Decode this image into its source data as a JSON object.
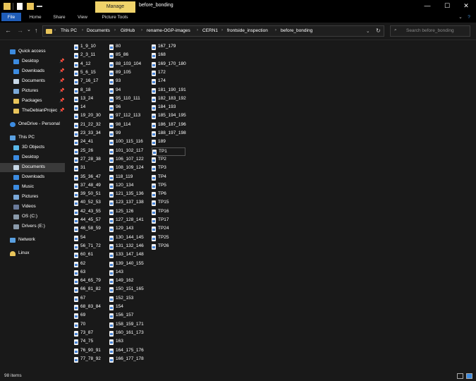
{
  "titlebar": {
    "manage_label": "Manage",
    "window_title": "before_bonding",
    "min_glyph": "—",
    "max_glyph": "☐",
    "close_glyph": "✕"
  },
  "ribbon": {
    "tabs": [
      "File",
      "Home",
      "Share",
      "View",
      "Picture Tools"
    ],
    "help_glyph": "?",
    "expand_glyph": "⌄"
  },
  "nav": {
    "back": "←",
    "forward": "→",
    "recent": "⌄",
    "up": "↑",
    "path": [
      "This PC",
      "Documents",
      "GitHub",
      "rename-OGP-images",
      "CERN1",
      "frontside_inspection",
      "before_bonding"
    ],
    "dropdown": "⌄",
    "refresh": "↻"
  },
  "search": {
    "placeholder": "Search before_bonding"
  },
  "sidebar": {
    "items": [
      {
        "label": "Quick access",
        "icon": "star-icon",
        "pinned": false
      },
      {
        "label": "Desktop",
        "icon": "desktop-icon",
        "pinned": true
      },
      {
        "label": "Downloads",
        "icon": "download-icon",
        "pinned": true
      },
      {
        "label": "Documents",
        "icon": "document-icon",
        "pinned": true
      },
      {
        "label": "Pictures",
        "icon": "picture-icon",
        "pinned": true
      },
      {
        "label": "Packages",
        "icon": "folder-icon",
        "pinned": true
      },
      {
        "label": "TheDebianProjec",
        "icon": "folder-icon",
        "pinned": true
      },
      {
        "label": "OneDrive - Personal",
        "icon": "cloud-icon",
        "pinned": false
      },
      {
        "label": "This PC",
        "icon": "computer-icon",
        "pinned": false
      },
      {
        "label": "3D Objects",
        "icon": "cube-icon",
        "pinned": false
      },
      {
        "label": "Desktop",
        "icon": "desktop-icon",
        "pinned": false
      },
      {
        "label": "Documents",
        "icon": "document-icon",
        "pinned": false,
        "selected": true
      },
      {
        "label": "Downloads",
        "icon": "download-icon",
        "pinned": false
      },
      {
        "label": "Music",
        "icon": "music-icon",
        "pinned": false
      },
      {
        "label": "Pictures",
        "icon": "picture-icon",
        "pinned": false
      },
      {
        "label": "Videos",
        "icon": "video-icon",
        "pinned": false
      },
      {
        "label": "OS (C:)",
        "icon": "drive-icon",
        "pinned": false
      },
      {
        "label": "Drivers (E:)",
        "icon": "drive-icon",
        "pinned": false
      },
      {
        "label": "Network",
        "icon": "network-icon",
        "pinned": false
      },
      {
        "label": "Linux",
        "icon": "linux-icon",
        "pinned": false
      }
    ]
  },
  "files": {
    "columns": [
      [
        "1_9_10",
        "2_3_11",
        "4_12",
        "5_6_15",
        "7_16_17",
        "8_18",
        "13_24",
        "14",
        "19_20_30",
        "21_22_32",
        "23_33_34",
        "24_41",
        "25_26",
        "27_28_38",
        "31",
        "35_36_47",
        "37_48_49",
        "39_50_51",
        "40_52_53",
        "42_43_55",
        "44_45_57",
        "46_58_59",
        "54",
        "56_71_72",
        "60_61",
        "62",
        "63",
        "64_65_79",
        "66_81_82",
        "67",
        "68_83_84",
        "69",
        "70",
        "73_87",
        "74_75",
        "76_90_91",
        "77_78_92"
      ],
      [
        "80",
        "85_86",
        "88_103_104",
        "89_105",
        "93",
        "94",
        "95_110_111",
        "96",
        "97_112_113",
        "98_114",
        "99",
        "100_115_116",
        "101_102_117",
        "106_107_122",
        "108_109_124",
        "118_119",
        "120_134",
        "121_135_136",
        "123_137_138",
        "125_126",
        "127_128_141",
        "129_143",
        "130_144_145",
        "131_132_146",
        "133_147_148",
        "139_140_155",
        "143",
        "149_162",
        "150_151_165",
        "152_153",
        "154",
        "156_157",
        "158_159_171",
        "160_161_173",
        "163",
        "164_175_176",
        "166_177_178"
      ],
      [
        "167_179",
        "168",
        "169_170_180",
        "172",
        "174",
        "181_190_191",
        "182_183_192",
        "184_193",
        "185_194_195",
        "186_187_196",
        "188_197_198",
        "189",
        "TP1",
        "TP2",
        "TP3",
        "TP4",
        "TP5",
        "TP6",
        "TP15",
        "TP16",
        "TP17",
        "TP24",
        "TP25",
        "TP26"
      ]
    ]
  },
  "status": {
    "count": "98 items"
  },
  "colors": {
    "accent": "#1f5db8",
    "manage_bg": "#f0d36a",
    "folder": "#e8c45a",
    "background": "#191919"
  }
}
